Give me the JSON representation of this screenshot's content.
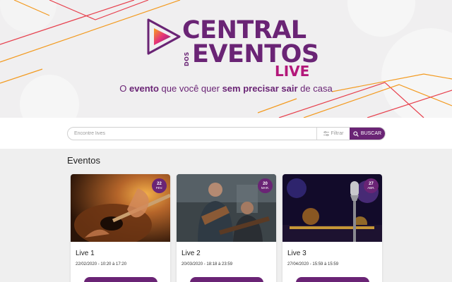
{
  "brand": {
    "name_line1": "CENTRAL",
    "name_dos": "DOS",
    "name_line2": "EVENTOS",
    "name_live": "LIVE",
    "tagline_parts": [
      "O ",
      "evento",
      " que você quer ",
      "sem precisar sair",
      " de casa"
    ],
    "colors": {
      "primary": "#6a2475",
      "accent": "#b3187a",
      "orange": "#f39a1f"
    }
  },
  "search": {
    "placeholder": "Encontre lives",
    "filter_label": "Filtrar",
    "filter_icon": "sliders-icon",
    "button_label": "BUSCAR",
    "button_icon": "search-icon"
  },
  "events": {
    "title": "Eventos",
    "items": [
      {
        "title": "Live 1",
        "dates": "22/02/2020 - 10:20 à 17:20",
        "day": "22",
        "month": "FEV.",
        "image": "guitar-closeup-photo"
      },
      {
        "title": "Live 2",
        "dates": "20/03/2020 - 18:18 à 23:59",
        "day": "20",
        "month": "MAR.",
        "image": "guitarists-photo"
      },
      {
        "title": "Live 3",
        "dates": "27/04/2020 - 15:59 à 15:59",
        "day": "27",
        "month": "ABR.",
        "image": "microphone-stage-photo"
      }
    ]
  }
}
